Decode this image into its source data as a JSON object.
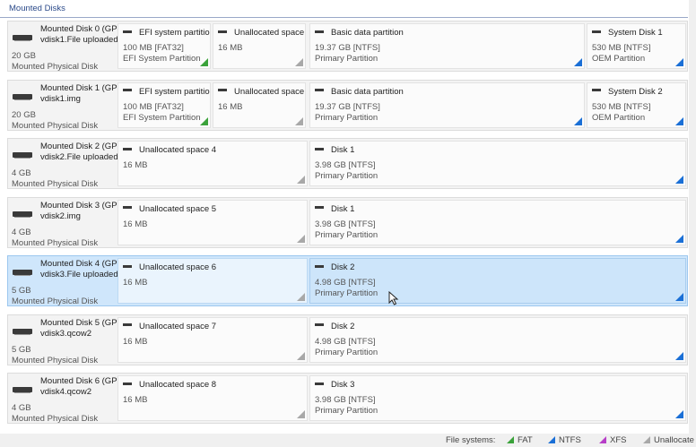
{
  "header": {
    "title": "Mounted Disks"
  },
  "disks": [
    {
      "name_line1": "Mounted Disk 0 (GP",
      "name_line2": "vdisk1.File uploaded",
      "size": "20 GB",
      "type": "Mounted Physical Disk",
      "partitions": [
        {
          "title": "EFI system partitior",
          "size": "100 MB [FAT32]",
          "type": "EFI System Partition",
          "fs": "fat"
        },
        {
          "title": "Unallocated space",
          "size": "16 MB",
          "type": "",
          "fs": "unalloc"
        },
        {
          "title": "Basic data partition",
          "size": "19.37 GB [NTFS]",
          "type": "Primary Partition",
          "fs": "ntfs"
        },
        {
          "title": "System Disk 1",
          "size": "530 MB [NTFS]",
          "type": "OEM Partition",
          "fs": "ntfs"
        }
      ]
    },
    {
      "name_line1": "Mounted Disk 1 (GP",
      "name_line2": "vdisk1.img",
      "size": "20 GB",
      "type": "Mounted Physical Disk",
      "partitions": [
        {
          "title": "EFI system partitior",
          "size": "100 MB [FAT32]",
          "type": "EFI System Partition",
          "fs": "fat"
        },
        {
          "title": "Unallocated space",
          "size": "16 MB",
          "type": "",
          "fs": "unalloc"
        },
        {
          "title": "Basic data partition",
          "size": "19.37 GB [NTFS]",
          "type": "Primary Partition",
          "fs": "ntfs"
        },
        {
          "title": "System Disk 2",
          "size": "530 MB [NTFS]",
          "type": "OEM Partition",
          "fs": "ntfs"
        }
      ]
    },
    {
      "name_line1": "Mounted Disk 2 (GP",
      "name_line2": "vdisk2.File uploaded",
      "size": "4 GB",
      "type": "Mounted Physical Disk",
      "partitions": [
        {
          "title": "Unallocated space 4",
          "size": "16 MB",
          "type": "",
          "fs": "unalloc"
        },
        {
          "title": "Disk 1",
          "size": "3.98 GB [NTFS]",
          "type": "Primary Partition",
          "fs": "ntfs"
        }
      ]
    },
    {
      "name_line1": "Mounted Disk 3 (GP",
      "name_line2": "vdisk2.img",
      "size": "4 GB",
      "type": "Mounted Physical Disk",
      "partitions": [
        {
          "title": "Unallocated space 5",
          "size": "16 MB",
          "type": "",
          "fs": "unalloc"
        },
        {
          "title": "Disk 1",
          "size": "3.98 GB [NTFS]",
          "type": "Primary Partition",
          "fs": "ntfs"
        }
      ]
    },
    {
      "name_line1": "Mounted Disk 4 (GP",
      "name_line2": "vdisk3.File uploaded",
      "size": "5 GB",
      "type": "Mounted Physical Disk",
      "selected": true,
      "partitions": [
        {
          "title": "Unallocated space 6",
          "size": "16 MB",
          "type": "",
          "fs": "unalloc"
        },
        {
          "title": "Disk 2",
          "size": "4.98 GB [NTFS]",
          "type": "Primary Partition",
          "fs": "ntfs",
          "selected": true
        }
      ]
    },
    {
      "name_line1": "Mounted Disk 5 (GP",
      "name_line2": "vdisk3.qcow2",
      "size": "5 GB",
      "type": "Mounted Physical Disk",
      "partitions": [
        {
          "title": "Unallocated space 7",
          "size": "16 MB",
          "type": "",
          "fs": "unalloc"
        },
        {
          "title": "Disk 2",
          "size": "4.98 GB [NTFS]",
          "type": "Primary Partition",
          "fs": "ntfs"
        }
      ]
    },
    {
      "name_line1": "Mounted Disk 6 (GP",
      "name_line2": "vdisk4.qcow2",
      "size": "4 GB",
      "type": "Mounted Physical Disk",
      "partitions": [
        {
          "title": "Unallocated space 8",
          "size": "16 MB",
          "type": "",
          "fs": "unalloc"
        },
        {
          "title": "Disk 3",
          "size": "3.98 GB [NTFS]",
          "type": "Primary Partition",
          "fs": "ntfs"
        }
      ]
    }
  ],
  "legend": {
    "label": "File systems:",
    "items": [
      {
        "label": "FAT",
        "fs": "fat"
      },
      {
        "label": "NTFS",
        "fs": "ntfs"
      },
      {
        "label": "XFS",
        "fs": "xfs"
      },
      {
        "label": "Unallocate",
        "fs": "unalloc"
      }
    ]
  },
  "colors": {
    "fat": "#3aa23a",
    "ntfs": "#1a6fd6",
    "xfs": "#b73ec8",
    "unalloc": "#a8a8a8",
    "selection": "#cfe6fb"
  },
  "icons": [
    "disk-drive-icon",
    "partition-icon",
    "mouse-cursor-icon"
  ]
}
